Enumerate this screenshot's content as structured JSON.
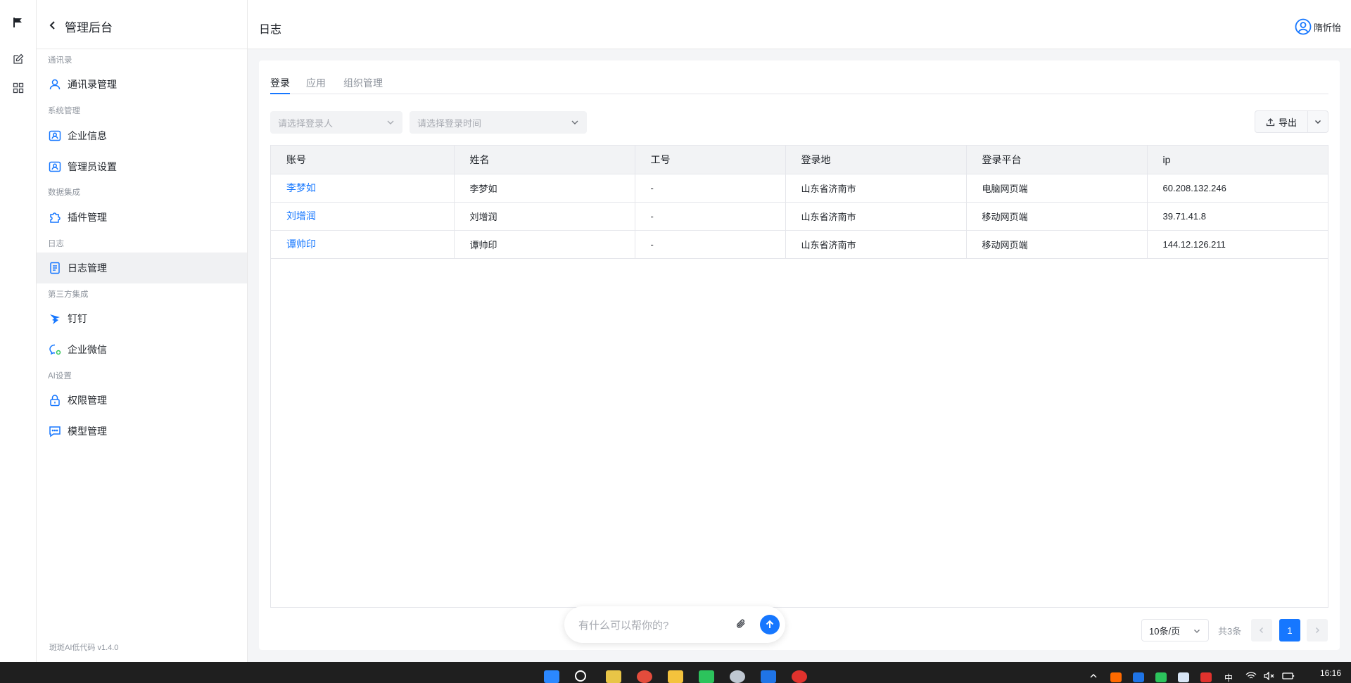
{
  "sidebar": {
    "title": "管理后台",
    "version": "斑斑AI低代码 v1.4.0",
    "groups": {
      "contacts": "通讯录",
      "system": "系统管理",
      "data": "数据集成",
      "log": "日志",
      "third": "第三方集成",
      "ai": "AI设置"
    },
    "items": {
      "contacts_mgmt": "通讯录管理",
      "company_info": "企业信息",
      "admin_settings": "管理员设置",
      "plugin_mgmt": "插件管理",
      "log_mgmt": "日志管理",
      "dingtalk": "钉钉",
      "wecom": "企业微信",
      "permission_mgmt": "权限管理",
      "model_mgmt": "模型管理"
    }
  },
  "header": {
    "page_title": "日志",
    "user_name": "隋忻怡"
  },
  "tabs": [
    "登录",
    "应用",
    "组织管理"
  ],
  "filters": {
    "user_placeholder": "请选择登录人",
    "time_placeholder": "请选择登录时间"
  },
  "export_label": "导出",
  "table": {
    "headers": [
      "账号",
      "姓名",
      "工号",
      "登录地",
      "登录平台",
      "ip"
    ],
    "rows": [
      [
        "李梦如",
        "李梦如",
        "-",
        "山东省济南市",
        "电脑网页端",
        "60.208.132.246"
      ],
      [
        "刘增润",
        "刘增润",
        "-",
        "山东省济南市",
        "移动网页端",
        "39.71.41.8"
      ],
      [
        "谭帅印",
        "谭帅印",
        "-",
        "山东省济南市",
        "移动网页端",
        "144.12.126.211"
      ]
    ]
  },
  "pagination": {
    "page_size": "10条/页",
    "total": "共3条",
    "current": "1"
  },
  "chat": {
    "placeholder": "有什么可以帮你的?"
  },
  "taskbar": {
    "time": "16:16",
    "ime": "中"
  },
  "colors": {
    "accent": "#1677ff",
    "sidebar_active_bg": "#f0f1f3",
    "content_bg": "#f4f5f7",
    "taskbar_bg": "#1f1f1f"
  }
}
